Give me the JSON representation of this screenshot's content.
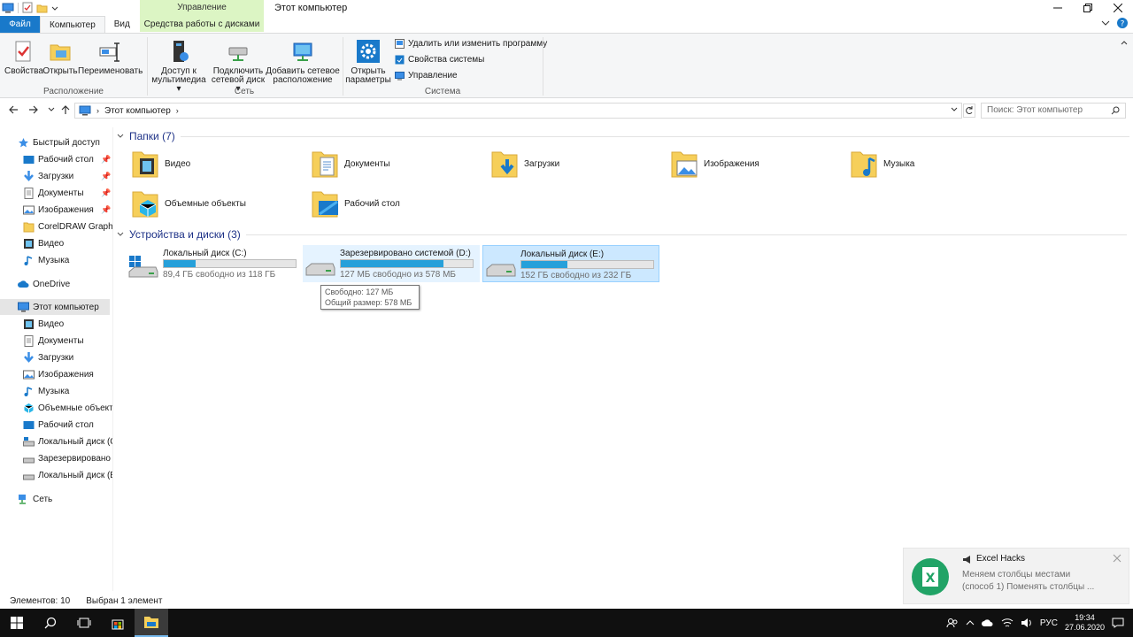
{
  "window": {
    "context_group": "Управление",
    "title": "Этот компьютер"
  },
  "tabs": {
    "file": "Файл",
    "computer": "Компьютер",
    "view": "Вид",
    "drive_tools": "Средства работы с дисками"
  },
  "ribbon": {
    "location": {
      "label": "Расположение",
      "properties": "Свойства",
      "open": "Открыть",
      "rename": "Переименовать"
    },
    "network": {
      "label": "Сеть",
      "media_access_1": "Доступ к",
      "media_access_2": "мультимедиа",
      "map_drive_1": "Подключить",
      "map_drive_2": "сетевой диск",
      "add_location_1": "Добавить сетевое",
      "add_location_2": "расположение"
    },
    "system": {
      "label": "Система",
      "open_settings_1": "Открыть",
      "open_settings_2": "параметры",
      "uninstall": "Удалить или изменить программу",
      "system_props": "Свойства системы",
      "manage": "Управление"
    }
  },
  "address": {
    "path": "Этот компьютер",
    "search_placeholder": "Поиск: Этот компьютер"
  },
  "nav": {
    "quick_access": "Быстрый доступ",
    "quick_items": [
      "Рабочий стол",
      "Загрузки",
      "Документы",
      "Изображения",
      "CorelDRAW Graphic",
      "Видео",
      "Музыка"
    ],
    "onedrive": "OneDrive",
    "this_pc": "Этот компьютер",
    "pc_items": [
      "Видео",
      "Документы",
      "Загрузки",
      "Изображения",
      "Музыка",
      "Объемные объекты",
      "Рабочий стол",
      "Локальный диск (C",
      "Зарезервировано с",
      "Локальный диск (E"
    ],
    "network": "Сеть"
  },
  "folders": {
    "header": "Папки (7)",
    "items": [
      "Видео",
      "Документы",
      "Загрузки",
      "Изображения",
      "Музыка",
      "Объемные объекты",
      "Рабочий стол"
    ]
  },
  "devices": {
    "header": "Устройства и диски (3)",
    "drives": [
      {
        "name": "Локальный диск (C:)",
        "free": "89,4 ГБ свободно из 118 ГБ",
        "used_fraction": 0.24
      },
      {
        "name": "Зарезервировано системой (D:)",
        "free": "127 МБ свободно из 578 МБ",
        "used_fraction": 0.78
      },
      {
        "name": "Локальный диск (E:)",
        "free": "152 ГБ свободно из 232 ГБ",
        "used_fraction": 0.35
      }
    ]
  },
  "tooltip": {
    "line1": "Свободно: 127 МБ",
    "line2": "Общий размер: 578 МБ"
  },
  "status": {
    "items_count": "Элементов: 10",
    "selected": "Выбран 1 элемент"
  },
  "toast": {
    "app": "Excel Hacks",
    "line1": "Меняем столбцы местами",
    "line2": "(способ 1)  Поменять столбцы ..."
  },
  "tray": {
    "lang": "РУС",
    "time": "19:34",
    "date": "27.06.2020"
  },
  "colors": {
    "accent": "#1979ca",
    "drive_bar": "#26a0da",
    "selection": "#cce8ff",
    "context_band": "#dcf5c4"
  }
}
